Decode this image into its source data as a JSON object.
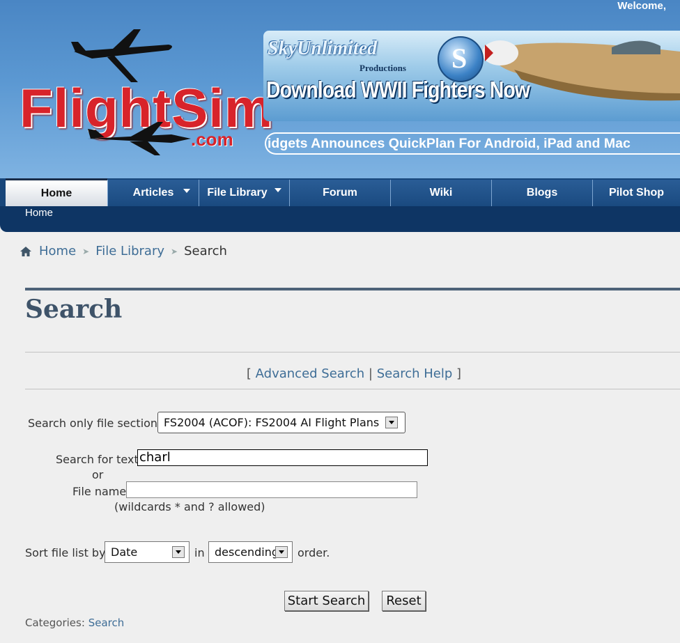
{
  "header": {
    "welcome": "Welcome,",
    "logo_text": "FlightSim",
    "logo_suffix": ".com",
    "ad_brand": "SkyUnlimited",
    "ad_productions": "Productions",
    "ad_logo_letter": "S",
    "ad_cta": "Download WWII Fighters Now",
    "ticker": "idgets Announces QuickPlan For Android, iPad and Mac"
  },
  "nav": {
    "items": [
      {
        "label": "Home",
        "dropdown": false,
        "active": true
      },
      {
        "label": "Articles",
        "dropdown": true,
        "active": false
      },
      {
        "label": "File Library",
        "dropdown": true,
        "active": false
      },
      {
        "label": "Forum",
        "dropdown": false,
        "active": false
      },
      {
        "label": "Wiki",
        "dropdown": false,
        "active": false
      },
      {
        "label": "Blogs",
        "dropdown": false,
        "active": false
      },
      {
        "label": "Pilot Shop",
        "dropdown": false,
        "active": false
      }
    ],
    "sub": "Home"
  },
  "breadcrumb": {
    "home": "Home",
    "library": "File Library",
    "current": "Search"
  },
  "page": {
    "title": "Search",
    "bracket_open": "[",
    "bracket_close": "]",
    "divider": "|",
    "advanced": "Advanced Search",
    "help": "Search Help"
  },
  "form": {
    "section_label": "Search only file section:",
    "section_value": "FS2004 (ACOF): FS2004 AI Flight Plans",
    "text_label": "Search for text",
    "text_value": "charl",
    "or": "or",
    "filename_label": "File name",
    "filename_value": "",
    "wildcards": "(wildcards * and ? allowed)",
    "sort_label": "Sort file list by",
    "sort_value": "Date",
    "in": "in",
    "order_value": "descending",
    "order_suffix": "order.",
    "start": "Start Search",
    "reset": "Reset"
  },
  "footer": {
    "label": "Categories:",
    "link": "Search"
  },
  "colors": {
    "nav": "#18467a",
    "link": "#3e6d96",
    "title": "#3e5369",
    "logo_red": "#d8232a"
  }
}
